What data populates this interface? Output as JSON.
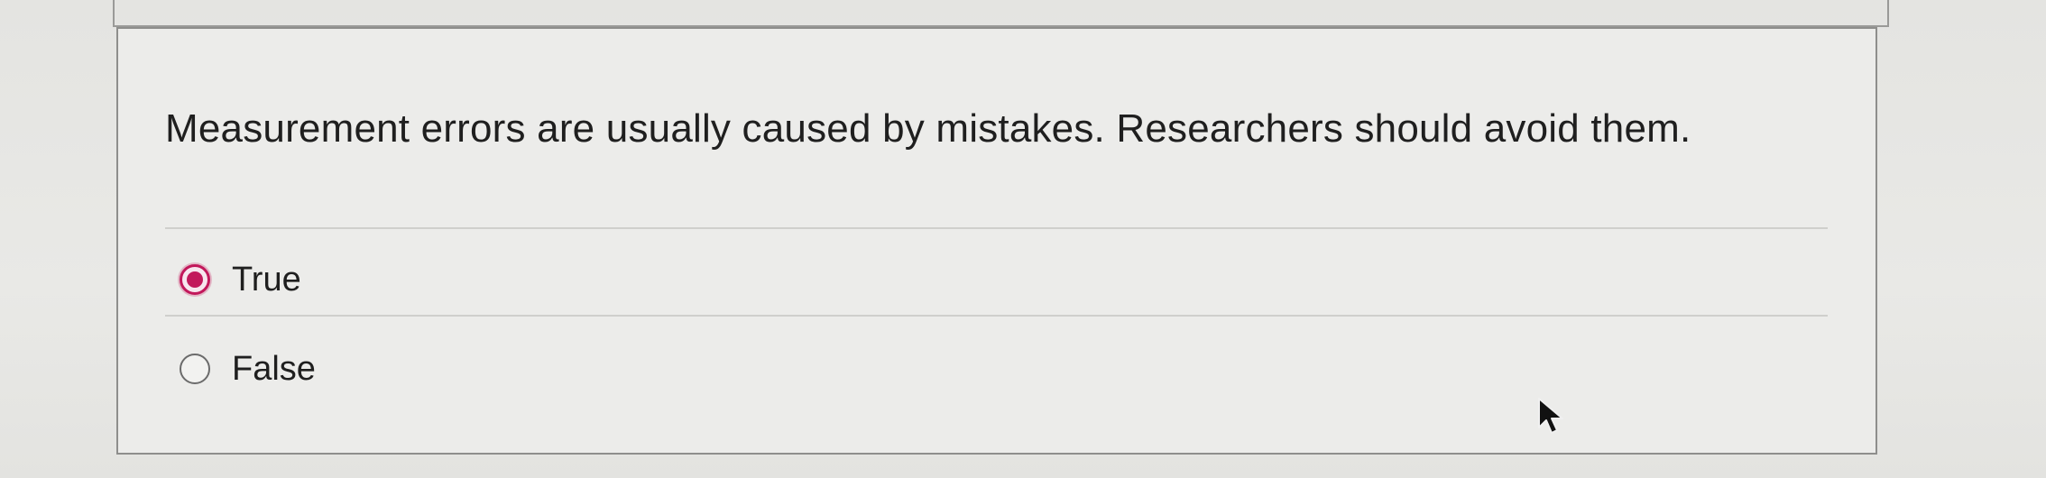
{
  "question": {
    "text": "Measurement errors are usually caused by mistakes. Researchers should avoid them."
  },
  "options": [
    {
      "label": "True",
      "selected": true
    },
    {
      "label": "False",
      "selected": false
    }
  ],
  "colors": {
    "accent": "#c2185b",
    "text": "#1f1f1f",
    "card_background": "#ececea",
    "card_border": "#8e8e8c"
  },
  "icons": {
    "cursor": "mouse-pointer-icon"
  }
}
